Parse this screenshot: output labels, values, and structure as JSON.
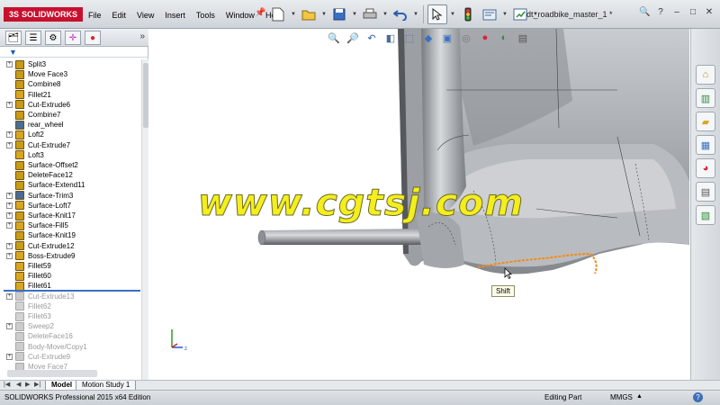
{
  "app": {
    "logo_text": "SOLIDWORKS",
    "document_title": "dt_roadbike_master_1 *",
    "menus": [
      "File",
      "Edit",
      "View",
      "Insert",
      "Tools",
      "Window",
      "Help"
    ]
  },
  "feature_tree": {
    "items": [
      {
        "label": "Split3",
        "suppressed": false,
        "expandable": true,
        "icon": "split-icon"
      },
      {
        "label": "Move Face3",
        "suppressed": false,
        "expandable": false,
        "icon": "move-face-icon"
      },
      {
        "label": "Combine8",
        "suppressed": false,
        "expandable": false,
        "icon": "combine-icon"
      },
      {
        "label": "Fillet21",
        "suppressed": false,
        "expandable": false,
        "icon": "fillet-icon"
      },
      {
        "label": "Cut-Extrude6",
        "suppressed": false,
        "expandable": true,
        "icon": "cut-extrude-icon"
      },
      {
        "label": "Combine7",
        "suppressed": false,
        "expandable": false,
        "icon": "combine-icon"
      },
      {
        "label": "rear_wheel",
        "suppressed": false,
        "expandable": false,
        "icon": "sketch-icon"
      },
      {
        "label": "Loft2",
        "suppressed": false,
        "expandable": true,
        "icon": "loft-icon"
      },
      {
        "label": "Cut-Extrude7",
        "suppressed": false,
        "expandable": true,
        "icon": "cut-extrude-icon"
      },
      {
        "label": "Loft3",
        "suppressed": false,
        "expandable": false,
        "icon": "loft-icon"
      },
      {
        "label": "Surface-Offset2",
        "suppressed": false,
        "expandable": false,
        "icon": "surface-offset-icon"
      },
      {
        "label": "DeleteFace12",
        "suppressed": false,
        "expandable": false,
        "icon": "delete-face-icon"
      },
      {
        "label": "Surface-Extend11",
        "suppressed": false,
        "expandable": false,
        "icon": "surface-extend-icon"
      },
      {
        "label": "Surface-Trim3",
        "suppressed": false,
        "expandable": true,
        "icon": "surface-trim-icon"
      },
      {
        "label": "Surface-Loft7",
        "suppressed": false,
        "expandable": true,
        "icon": "surface-loft-icon"
      },
      {
        "label": "Surface-Knit17",
        "suppressed": false,
        "expandable": true,
        "icon": "surface-knit-icon"
      },
      {
        "label": "Surface-Fill5",
        "suppressed": false,
        "expandable": true,
        "icon": "surface-fill-icon"
      },
      {
        "label": "Surface-Knit19",
        "suppressed": false,
        "expandable": false,
        "icon": "surface-knit-icon"
      },
      {
        "label": "Cut-Extrude12",
        "suppressed": false,
        "expandable": true,
        "icon": "cut-extrude-icon"
      },
      {
        "label": "Boss-Extrude9",
        "suppressed": false,
        "expandable": true,
        "icon": "boss-extrude-icon"
      },
      {
        "label": "Fillet59",
        "suppressed": false,
        "expandable": false,
        "icon": "fillet-icon"
      },
      {
        "label": "Fillet60",
        "suppressed": false,
        "expandable": false,
        "icon": "fillet-icon"
      },
      {
        "label": "Fillet61",
        "suppressed": false,
        "expandable": false,
        "icon": "fillet-icon"
      },
      {
        "label": "Cut-Extrude13",
        "suppressed": true,
        "expandable": true,
        "icon": "cut-extrude-icon"
      },
      {
        "label": "Fillet62",
        "suppressed": true,
        "expandable": false,
        "icon": "fillet-icon"
      },
      {
        "label": "Fillet63",
        "suppressed": true,
        "expandable": false,
        "icon": "fillet-icon"
      },
      {
        "label": "Sweep2",
        "suppressed": true,
        "expandable": true,
        "icon": "sweep-icon"
      },
      {
        "label": "DeleteFace16",
        "suppressed": true,
        "expandable": false,
        "icon": "delete-face-icon"
      },
      {
        "label": "Body-Move/Copy1",
        "suppressed": true,
        "expandable": false,
        "icon": "body-move-icon"
      },
      {
        "label": "Cut-Extrude9",
        "suppressed": true,
        "expandable": true,
        "icon": "cut-extrude-icon"
      },
      {
        "label": "Move Face7",
        "suppressed": true,
        "expandable": false,
        "icon": "move-face-icon"
      }
    ]
  },
  "model_tabs": [
    "Model",
    "Motion Study 1"
  ],
  "graphics": {
    "watermark": "www.cgtsj.com",
    "tooltip": "Shift"
  },
  "status": {
    "edition": "SOLIDWORKS Professional 2015 x64 Edition",
    "mode": "Editing Part",
    "units": "MMGS"
  }
}
